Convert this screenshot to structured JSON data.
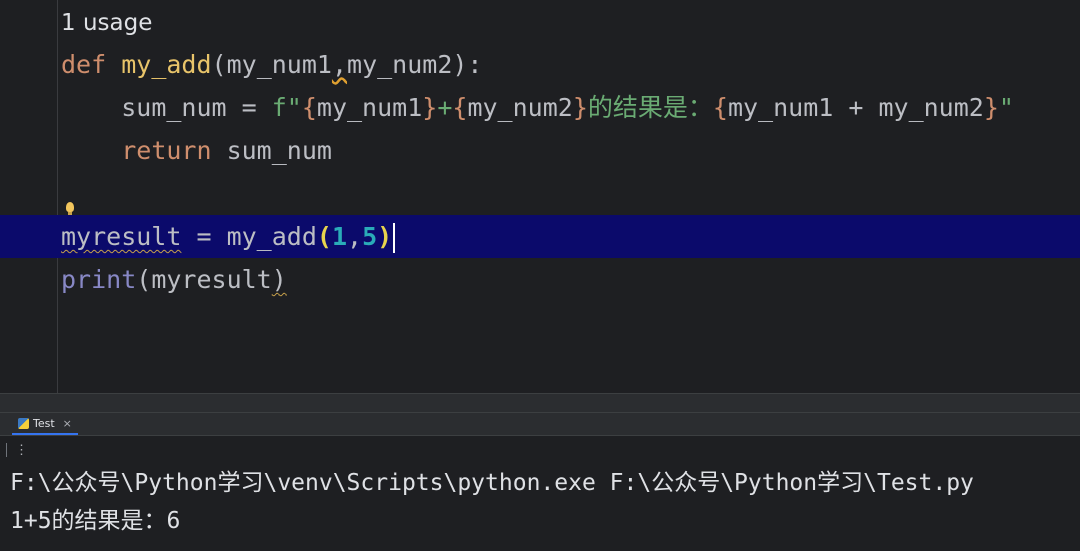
{
  "editor": {
    "usage_hint": "1 usage",
    "line1": {
      "kw": "def",
      "fn": "my_add",
      "open": "(",
      "p1": "my_num1",
      "comma": ",",
      "p2": "my_num2",
      "close": "):"
    },
    "line2": {
      "indent": "    ",
      "var": "sum_num",
      "eq": " = ",
      "prefix": "f\"",
      "b1o": "{",
      "v1": "my_num1",
      "b1c": "}",
      "plus": "+",
      "b2o": "{",
      "v2": "my_num2",
      "b2c": "}",
      "text": "的结果是：",
      "b3o": "{",
      "expr": "my_num1 + my_num2",
      "b3c": "}",
      "quote": "\""
    },
    "line3": {
      "indent": "    ",
      "kw": "return",
      "var": " sum_num"
    },
    "line5": {
      "var": "myresult",
      "eq": " = ",
      "fn": "my_add",
      "open": "(",
      "a1": "1",
      "comma": ",",
      "a2": "5",
      "close": ")"
    },
    "line6": {
      "fn": "print",
      "open": "(",
      "arg": "myresult",
      "close": ")"
    }
  },
  "tool_window": {
    "tab_label": "Test",
    "tab_close": "×",
    "toolbar_more": "⋮"
  },
  "console": {
    "lines": [
      "F:\\公众号\\Python学习\\venv\\Scripts\\python.exe F:\\公众号\\Python学习\\Test.py",
      "1+5的结果是：6"
    ]
  }
}
